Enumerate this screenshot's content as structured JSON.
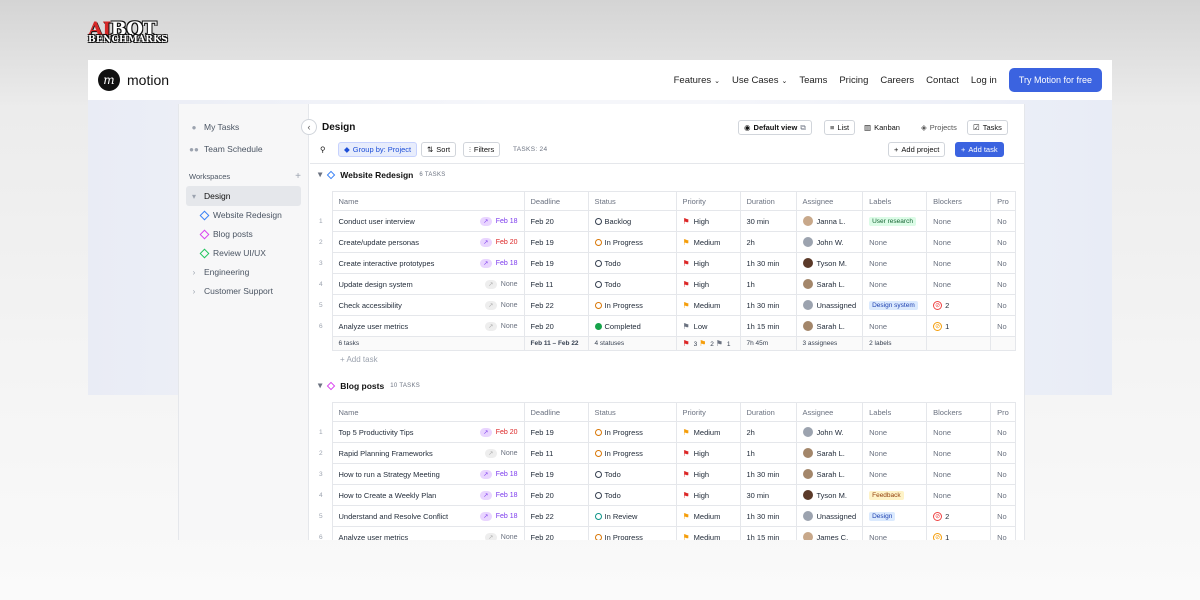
{
  "watermark": {
    "line1a": "AI",
    "line1b": "BOT",
    "line2": "BENCHMARKS"
  },
  "nav": {
    "logo": "motion",
    "links": [
      {
        "label": "Features",
        "dropdown": true
      },
      {
        "label": "Use Cases",
        "dropdown": true
      },
      {
        "label": "Teams"
      },
      {
        "label": "Pricing"
      },
      {
        "label": "Careers"
      },
      {
        "label": "Contact"
      },
      {
        "label": "Log in"
      }
    ],
    "cta": "Try Motion for free"
  },
  "sidebar": {
    "my_tasks": "My Tasks",
    "team_schedule": "Team Schedule",
    "workspaces": "Workspaces",
    "design": "Design",
    "projects": [
      {
        "label": "Website Redesign",
        "color": "#3b82f6"
      },
      {
        "label": "Blog posts",
        "color": "#d946ef"
      },
      {
        "label": "Review UI/UX",
        "color": "#22c55e"
      }
    ],
    "engineering": "Engineering",
    "customer_support": "Customer Support"
  },
  "toolbar": {
    "title": "Design",
    "default_view": "Default view",
    "list": "List",
    "kanban": "Kanban",
    "projects": "Projects",
    "tasks": "Tasks",
    "group_by": "Group by: Project",
    "sort": "Sort",
    "filters": "Filters",
    "task_count": "TASKS: 24",
    "add_project": "Add project",
    "add_task": "Add task"
  },
  "columns": [
    "Name",
    "Deadline",
    "Status",
    "Priority",
    "Duration",
    "Assignee",
    "Labels",
    "Blockers",
    "Pro"
  ],
  "groups": [
    {
      "name": "Website Redesign",
      "count": "6 TASKS",
      "color": "#3b82f6",
      "rows": [
        [
          "1",
          "Conduct user interview",
          "Feb 18",
          "Feb 20",
          "Backlog",
          "High",
          "30 min",
          "Janna L.",
          "User research",
          "None",
          "No"
        ],
        [
          "2",
          "Create/update personas",
          "Feb 20",
          "Feb 19",
          "In Progress",
          "Medium",
          "2h",
          "John W.",
          "None",
          "None",
          "No"
        ],
        [
          "3",
          "Create interactive prototypes",
          "Feb 18",
          "Feb 19",
          "Todo",
          "High",
          "1h 30 min",
          "Tyson M.",
          "None",
          "None",
          "No"
        ],
        [
          "4",
          "Update design system",
          "None",
          "Feb 11",
          "Todo",
          "High",
          "1h",
          "Sarah L.",
          "None",
          "None",
          "No"
        ],
        [
          "5",
          "Check accessibility",
          "None",
          "Feb 22",
          "In Progress",
          "Medium",
          "1h 30 min",
          "Unassigned",
          "Design system",
          "2",
          "No"
        ],
        [
          "6",
          "Analyze user metrics",
          "None",
          "Feb 20",
          "Completed",
          "Low",
          "1h 15 min",
          "Sarah L.",
          "None",
          "1",
          "No"
        ]
      ],
      "summary": {
        "tasks": "6 tasks",
        "deadline": "Feb 11 – Feb 22",
        "statuses": "4 statuses",
        "p_high": "3",
        "p_med": "2",
        "p_low": "1",
        "duration": "7h 45m",
        "assignees": "3 assignees",
        "labels": "2 labels"
      },
      "add_task": "Add task"
    },
    {
      "name": "Blog posts",
      "count": "10 TASKS",
      "color": "#d946ef",
      "rows": [
        [
          "1",
          "Top 5 Productivity Tips",
          "Feb 20",
          "Feb 19",
          "In Progress",
          "Medium",
          "2h",
          "John W.",
          "None",
          "None",
          "No"
        ],
        [
          "2",
          "Rapid Planning Frameworks",
          "None",
          "Feb 11",
          "In Progress",
          "High",
          "1h",
          "Sarah L.",
          "None",
          "None",
          "No"
        ],
        [
          "3",
          "How to run a Strategy Meeting",
          "Feb 18",
          "Feb 19",
          "Todo",
          "High",
          "1h 30 min",
          "Sarah L.",
          "None",
          "None",
          "No"
        ],
        [
          "4",
          "How to Create a Weekly Plan",
          "Feb 18",
          "Feb 20",
          "Todo",
          "High",
          "30 min",
          "Tyson M.",
          "Feedback",
          "None",
          "No"
        ],
        [
          "5",
          "Understand and Resolve Conflict",
          "Feb 18",
          "Feb 22",
          "In Review",
          "Medium",
          "1h 30 min",
          "Unassigned",
          "Design",
          "2",
          "No"
        ],
        [
          "6",
          "Analyze user metrics",
          "None",
          "Feb 20",
          "In Progress",
          "Medium",
          "1h 15 min",
          "James C.",
          "None",
          "1",
          "No"
        ]
      ]
    }
  ]
}
